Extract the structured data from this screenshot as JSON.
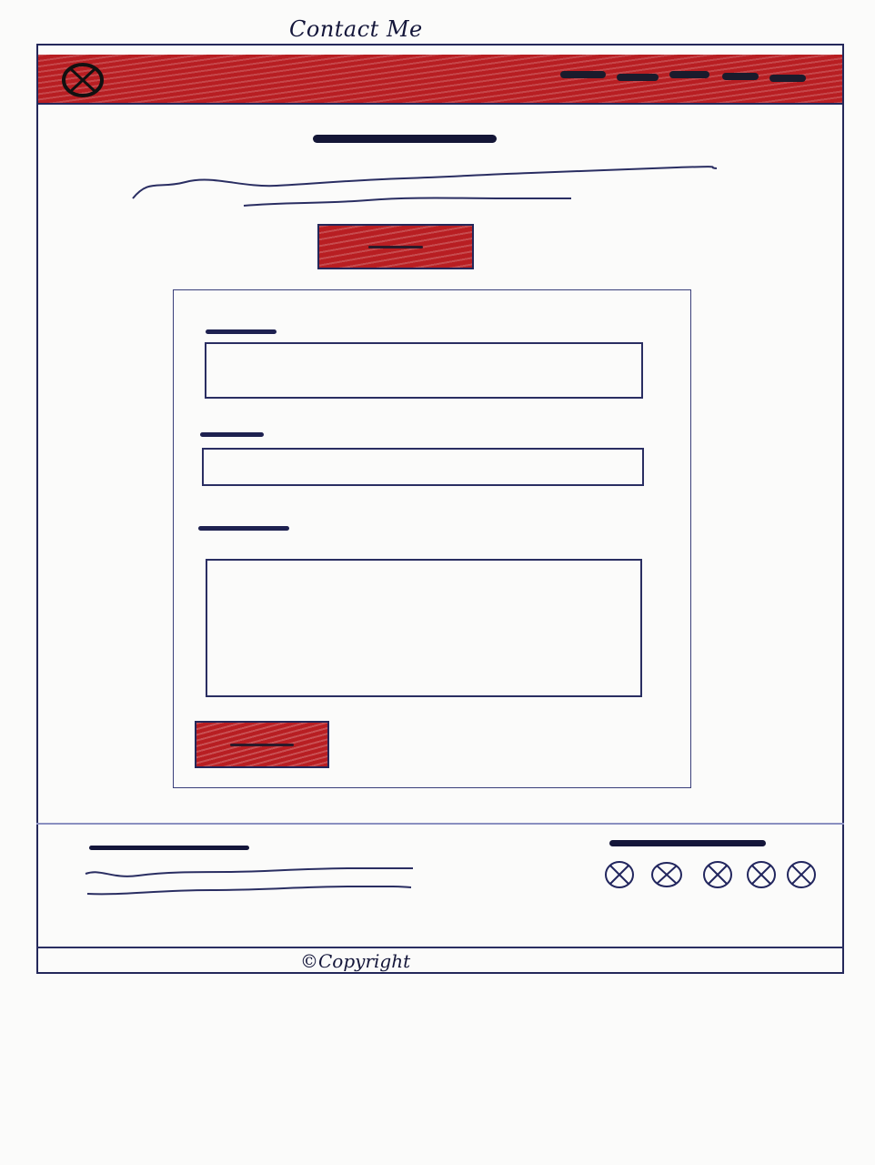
{
  "sheet": {
    "title": "Contact Me"
  },
  "header": {
    "logo_icon": "placeholder-x-icon",
    "nav_items_count_visible": 5,
    "accent_color": "#b81e22"
  },
  "hero": {
    "button_icon": "placeholder-line"
  },
  "form": {
    "fields": [
      "input",
      "input",
      "textarea"
    ]
  },
  "footer": {
    "social_icons": [
      "placeholder-x-icon",
      "placeholder-x-icon",
      "placeholder-x-icon",
      "placeholder-x-icon",
      "placeholder-x-icon"
    ],
    "copyright": "©Copyright"
  }
}
